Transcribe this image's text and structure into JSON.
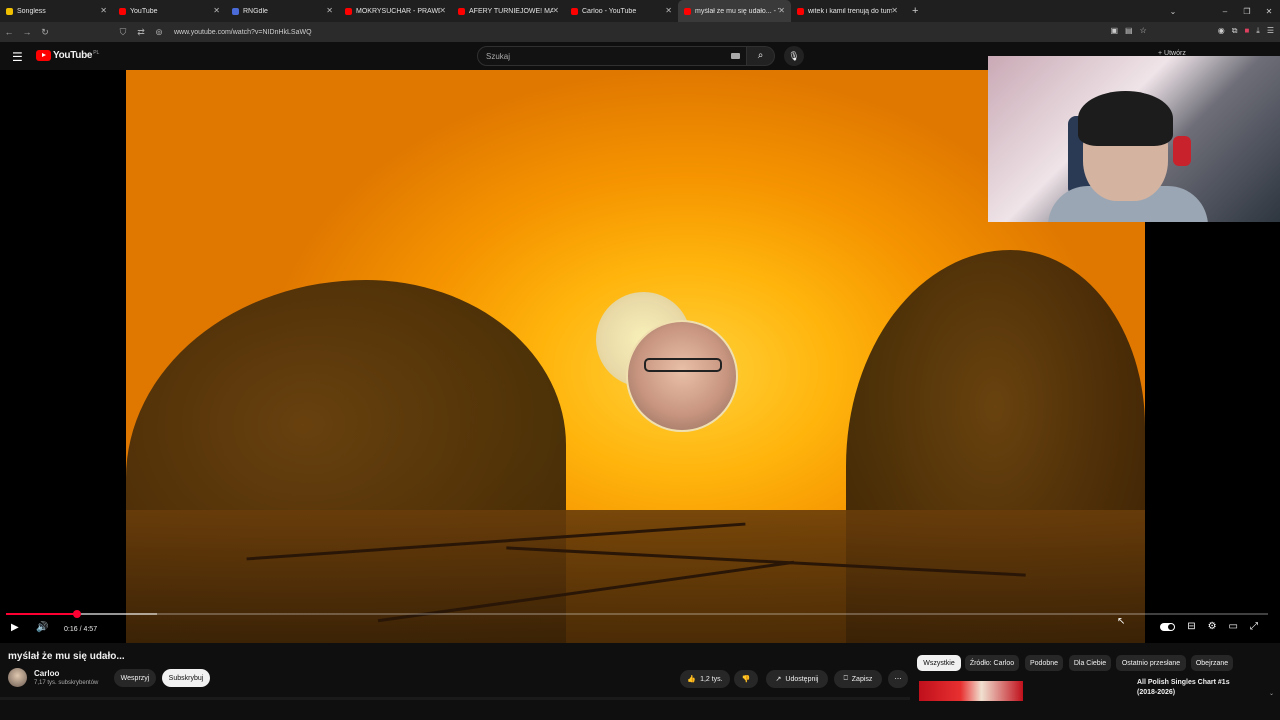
{
  "browser": {
    "tabs": [
      {
        "title": "Songless",
        "fav_color": "#f0c000",
        "active": false
      },
      {
        "title": "YouTube",
        "fav_color": "#ff0000",
        "active": false
      },
      {
        "title": "RNGdle",
        "fav_color": "#4a6ad8",
        "active": false
      },
      {
        "title": "MOKRYSUCHAR - PRAWDZIWA",
        "fav_color": "#ff0000",
        "active": false
      },
      {
        "title": "AFERY TURNIEJOWE! MAMMO",
        "fav_color": "#ff0000",
        "active": false
      },
      {
        "title": "Carloo - YouTube",
        "fav_color": "#ff0000",
        "active": false
      },
      {
        "title": "myślał że mu się udało... - YouT",
        "fav_color": "#ff0000",
        "active": true
      },
      {
        "title": "witek i kamil trenują do turniej",
        "fav_color": "#ff0000",
        "active": false
      }
    ],
    "new_tab_label": "+",
    "url": "www.youtube.com/watch?v=NIDnHkLSaWQ"
  },
  "header": {
    "menu_icon": "hamburger-icon",
    "logo_text": "YouTube",
    "logo_country": "PL",
    "search_placeholder": "Szukaj",
    "create_label": "Utwórz"
  },
  "player": {
    "current_time": "0:16",
    "duration": "4:57",
    "time_display": "0:16 / 4:57",
    "played_fraction": 0.056,
    "buffered_fraction": 0.12,
    "accent_color": "#ff0033"
  },
  "video": {
    "title": "myślał że mu się udało...",
    "channel_name": "Carloo",
    "subscribers": "7,17 tys. subskrybentów",
    "support_label": "Wesprzyj",
    "subscribe_label": "Subskrybuj",
    "likes": "1,2 tys.",
    "share_label": "Udostępnij",
    "save_label": "Zapisz"
  },
  "filters": [
    "Wszystkie",
    "Źródło: Carloo",
    "Podobne",
    "Dla Ciebie",
    "Ostatnio przesłane",
    "Obejrzane"
  ],
  "recommended": {
    "title": "All Polish Singles Chart #1s (2018-2026)"
  }
}
